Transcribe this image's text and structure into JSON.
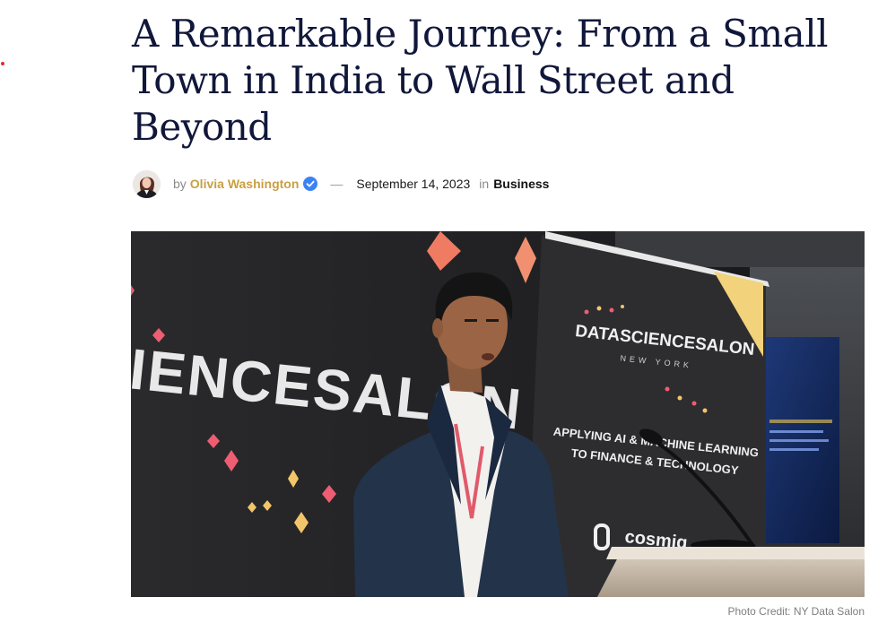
{
  "article": {
    "title": "A Remarkable Journey: From a Small Town in India to Wall Street and Beyond",
    "by_label": "by",
    "author": "Olivia Washington",
    "separator": "—",
    "date": "September 14, 2023",
    "in_label": "in",
    "category": "Business"
  },
  "hero_image": {
    "banner_left_text": "IENCESALON",
    "banner_right_title": "DATASCIENCESALON",
    "banner_right_city": "NEW YORK",
    "banner_right_line1": "APPLYING AI & MACHINE LEARNING",
    "banner_right_line2": "TO FINANCE & TECHNOLOGY",
    "sponsor": "cosmiq",
    "credit": "Photo Credit: NY Data Salon"
  },
  "icons": {
    "verified": "verified-badge-icon",
    "avatar": "author-avatar"
  },
  "colors": {
    "title": "#10173a",
    "author": "#c9a042",
    "verified": "#3b82f6",
    "accent_dot": "#e32b2b"
  }
}
